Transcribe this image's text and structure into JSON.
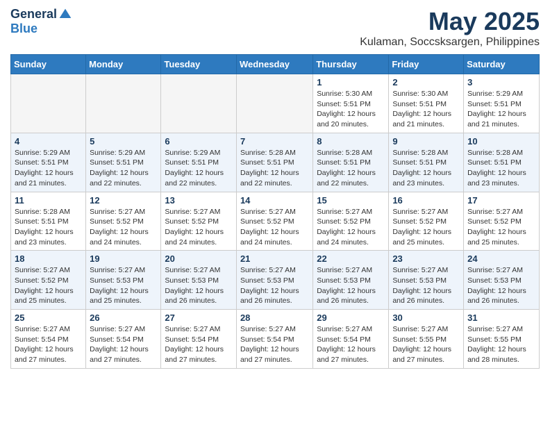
{
  "header": {
    "logo_general": "General",
    "logo_blue": "Blue",
    "month_title": "May 2025",
    "location": "Kulaman, Soccsksargen, Philippines"
  },
  "weekdays": [
    "Sunday",
    "Monday",
    "Tuesday",
    "Wednesday",
    "Thursday",
    "Friday",
    "Saturday"
  ],
  "weeks": [
    {
      "days": [
        {
          "num": "",
          "empty": true
        },
        {
          "num": "",
          "empty": true
        },
        {
          "num": "",
          "empty": true
        },
        {
          "num": "",
          "empty": true
        },
        {
          "num": "1",
          "sunrise": "5:30 AM",
          "sunset": "5:51 PM",
          "daylight": "12 hours and 20 minutes."
        },
        {
          "num": "2",
          "sunrise": "5:30 AM",
          "sunset": "5:51 PM",
          "daylight": "12 hours and 21 minutes."
        },
        {
          "num": "3",
          "sunrise": "5:29 AM",
          "sunset": "5:51 PM",
          "daylight": "12 hours and 21 minutes."
        }
      ]
    },
    {
      "days": [
        {
          "num": "4",
          "sunrise": "5:29 AM",
          "sunset": "5:51 PM",
          "daylight": "12 hours and 21 minutes."
        },
        {
          "num": "5",
          "sunrise": "5:29 AM",
          "sunset": "5:51 PM",
          "daylight": "12 hours and 22 minutes."
        },
        {
          "num": "6",
          "sunrise": "5:29 AM",
          "sunset": "5:51 PM",
          "daylight": "12 hours and 22 minutes."
        },
        {
          "num": "7",
          "sunrise": "5:28 AM",
          "sunset": "5:51 PM",
          "daylight": "12 hours and 22 minutes."
        },
        {
          "num": "8",
          "sunrise": "5:28 AM",
          "sunset": "5:51 PM",
          "daylight": "12 hours and 22 minutes."
        },
        {
          "num": "9",
          "sunrise": "5:28 AM",
          "sunset": "5:51 PM",
          "daylight": "12 hours and 23 minutes."
        },
        {
          "num": "10",
          "sunrise": "5:28 AM",
          "sunset": "5:51 PM",
          "daylight": "12 hours and 23 minutes."
        }
      ]
    },
    {
      "days": [
        {
          "num": "11",
          "sunrise": "5:28 AM",
          "sunset": "5:51 PM",
          "daylight": "12 hours and 23 minutes."
        },
        {
          "num": "12",
          "sunrise": "5:27 AM",
          "sunset": "5:52 PM",
          "daylight": "12 hours and 24 minutes."
        },
        {
          "num": "13",
          "sunrise": "5:27 AM",
          "sunset": "5:52 PM",
          "daylight": "12 hours and 24 minutes."
        },
        {
          "num": "14",
          "sunrise": "5:27 AM",
          "sunset": "5:52 PM",
          "daylight": "12 hours and 24 minutes."
        },
        {
          "num": "15",
          "sunrise": "5:27 AM",
          "sunset": "5:52 PM",
          "daylight": "12 hours and 24 minutes."
        },
        {
          "num": "16",
          "sunrise": "5:27 AM",
          "sunset": "5:52 PM",
          "daylight": "12 hours and 25 minutes."
        },
        {
          "num": "17",
          "sunrise": "5:27 AM",
          "sunset": "5:52 PM",
          "daylight": "12 hours and 25 minutes."
        }
      ]
    },
    {
      "days": [
        {
          "num": "18",
          "sunrise": "5:27 AM",
          "sunset": "5:52 PM",
          "daylight": "12 hours and 25 minutes."
        },
        {
          "num": "19",
          "sunrise": "5:27 AM",
          "sunset": "5:53 PM",
          "daylight": "12 hours and 25 minutes."
        },
        {
          "num": "20",
          "sunrise": "5:27 AM",
          "sunset": "5:53 PM",
          "daylight": "12 hours and 26 minutes."
        },
        {
          "num": "21",
          "sunrise": "5:27 AM",
          "sunset": "5:53 PM",
          "daylight": "12 hours and 26 minutes."
        },
        {
          "num": "22",
          "sunrise": "5:27 AM",
          "sunset": "5:53 PM",
          "daylight": "12 hours and 26 minutes."
        },
        {
          "num": "23",
          "sunrise": "5:27 AM",
          "sunset": "5:53 PM",
          "daylight": "12 hours and 26 minutes."
        },
        {
          "num": "24",
          "sunrise": "5:27 AM",
          "sunset": "5:53 PM",
          "daylight": "12 hours and 26 minutes."
        }
      ]
    },
    {
      "days": [
        {
          "num": "25",
          "sunrise": "5:27 AM",
          "sunset": "5:54 PM",
          "daylight": "12 hours and 27 minutes."
        },
        {
          "num": "26",
          "sunrise": "5:27 AM",
          "sunset": "5:54 PM",
          "daylight": "12 hours and 27 minutes."
        },
        {
          "num": "27",
          "sunrise": "5:27 AM",
          "sunset": "5:54 PM",
          "daylight": "12 hours and 27 minutes."
        },
        {
          "num": "28",
          "sunrise": "5:27 AM",
          "sunset": "5:54 PM",
          "daylight": "12 hours and 27 minutes."
        },
        {
          "num": "29",
          "sunrise": "5:27 AM",
          "sunset": "5:54 PM",
          "daylight": "12 hours and 27 minutes."
        },
        {
          "num": "30",
          "sunrise": "5:27 AM",
          "sunset": "5:55 PM",
          "daylight": "12 hours and 27 minutes."
        },
        {
          "num": "31",
          "sunrise": "5:27 AM",
          "sunset": "5:55 PM",
          "daylight": "12 hours and 28 minutes."
        }
      ]
    }
  ]
}
